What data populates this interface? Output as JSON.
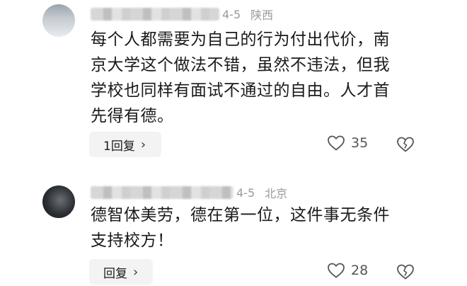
{
  "comments": [
    {
      "date": "4-5",
      "location": "陕西",
      "text": "每个人都需要为自己的行为付出代价，南\n京大学这个做法不错，虽然不违法，但我\n学校也同样有面试不通过的自由。人才首\n先得有德。",
      "reply_label": "1回复",
      "likes": "35"
    },
    {
      "date": "4-5",
      "location": "北京",
      "text": "德智体美劳，德在第一位，这件事无条件\n支持校方！",
      "reply_label": "回复",
      "likes": "28"
    }
  ],
  "icons": {
    "like": "heart-icon",
    "dislike": "broken-heart-icon",
    "reply_chevron": "chevron-right-icon"
  }
}
